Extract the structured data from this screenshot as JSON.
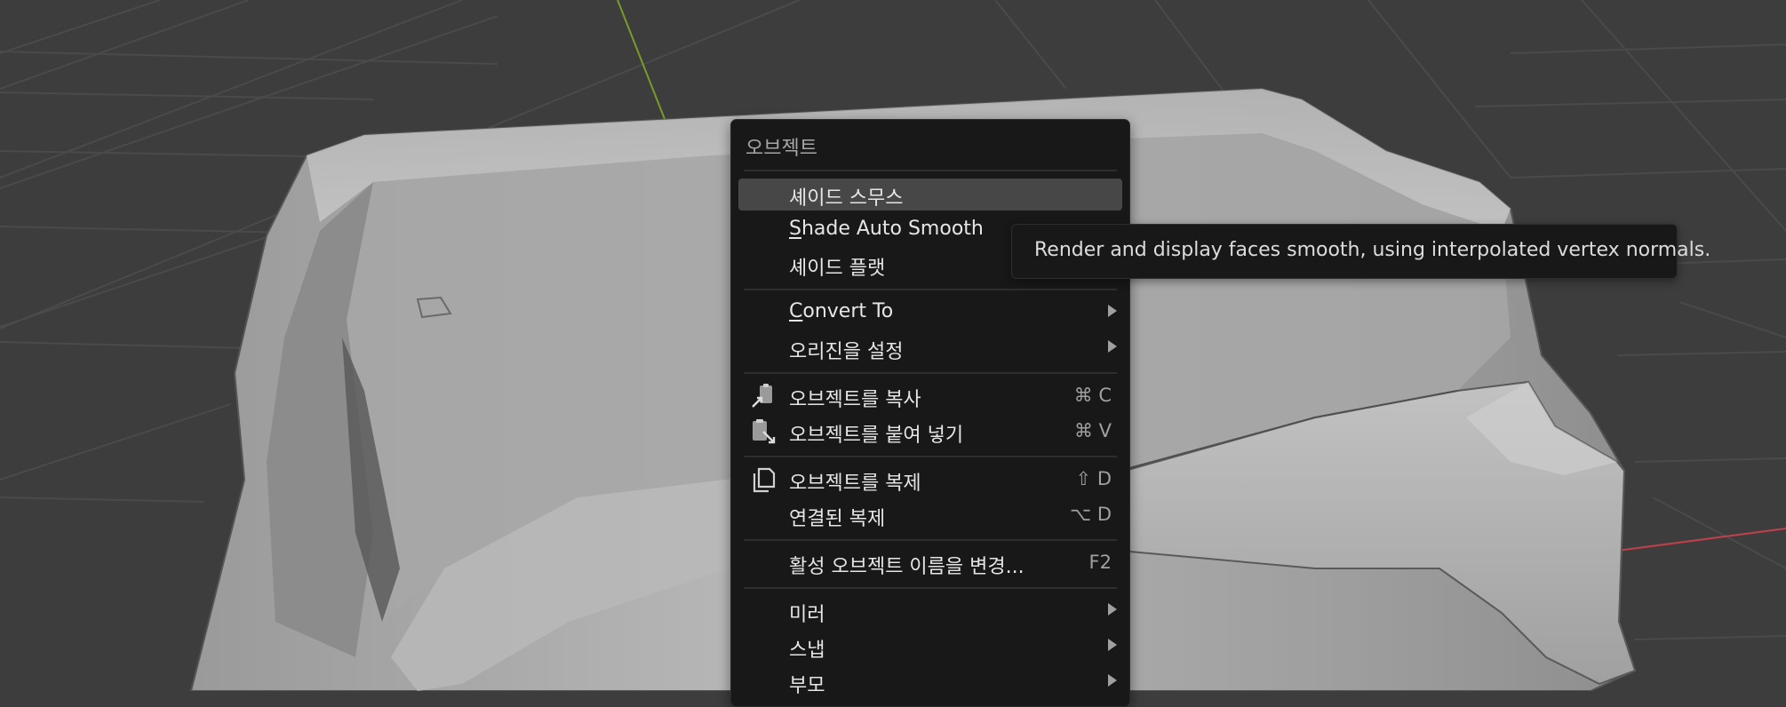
{
  "menu": {
    "title": "오브젝트",
    "items": [
      {
        "id": "shade-smooth",
        "label": "셰이드 스무스",
        "shortcut": "",
        "submenu": false,
        "highlighted": true
      },
      {
        "id": "shade-auto-smooth",
        "label_underlined": "S",
        "label_rest": "hade Auto Smooth",
        "shortcut": "",
        "submenu": false
      },
      {
        "id": "shade-flat",
        "label": "셰이드 플랫",
        "shortcut": "",
        "submenu": false
      },
      {
        "id": "convert-to",
        "label_underlined": "C",
        "label_rest": "onvert To",
        "shortcut": "",
        "submenu": true
      },
      {
        "id": "set-origin",
        "label": "오리진을 설정",
        "shortcut": "",
        "submenu": true
      },
      {
        "id": "copy-objects",
        "label": "오브젝트를 복사",
        "shortcut": "⌘ C",
        "submenu": false,
        "icon": "copy-clipboard-icon"
      },
      {
        "id": "paste-objects",
        "label": "오브젝트를 붙여 넣기",
        "shortcut": "⌘ V",
        "submenu": false,
        "icon": "paste-clipboard-icon"
      },
      {
        "id": "duplicate-objects",
        "label": "오브젝트를 복제",
        "shortcut": "⇧ D",
        "submenu": false,
        "icon": "duplicate-icon"
      },
      {
        "id": "duplicate-linked",
        "label": "연결된 복제",
        "shortcut": "⌥ D",
        "submenu": false
      },
      {
        "id": "rename-active",
        "label": "활성 오브젝트 이름을 변경...",
        "shortcut": "F2",
        "submenu": false
      },
      {
        "id": "mirror",
        "label": "미러",
        "shortcut": "",
        "submenu": true
      },
      {
        "id": "snap",
        "label": "스냅",
        "shortcut": "",
        "submenu": true
      },
      {
        "id": "parent",
        "label": "부모",
        "shortcut": "",
        "submenu": true
      }
    ]
  },
  "tooltip": {
    "text": "Render and display faces smooth, using interpolated vertex normals."
  },
  "colors": {
    "viewport_background": "#3d3d3d",
    "menu_background": "#181818",
    "highlight": "#474747",
    "axis_x": "#c0404a",
    "axis_y": "#7a9a2a"
  }
}
